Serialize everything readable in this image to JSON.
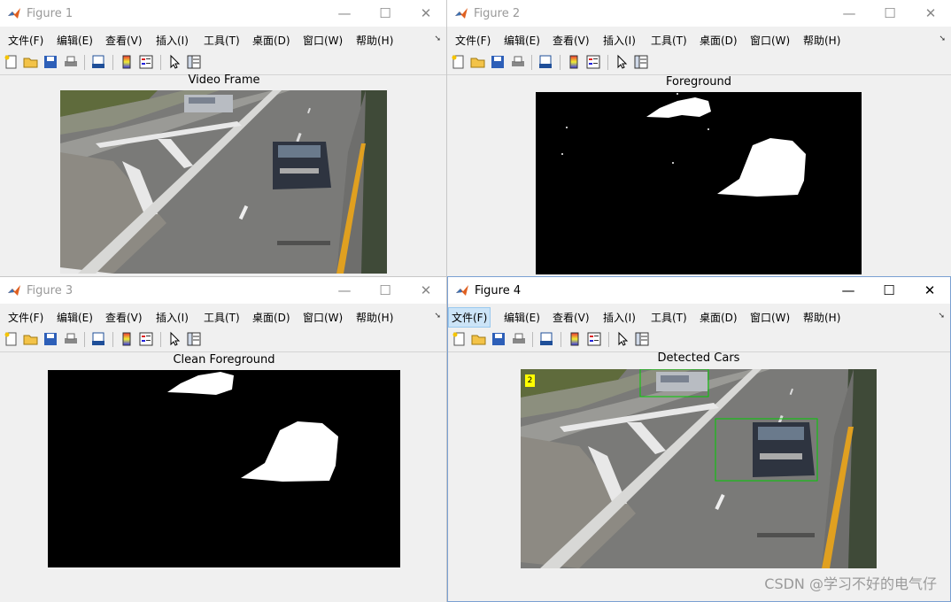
{
  "menu_labels": [
    "文件(F)",
    "编辑(E)",
    "查看(V)",
    "插入(I)",
    "工具(T)",
    "桌面(D)",
    "窗口(W)",
    "帮助(H)"
  ],
  "toolbar_icons": [
    "new-figure-icon",
    "open-file-icon",
    "save-icon",
    "print-icon",
    "print-preview-icon",
    "colorbar-icon",
    "legend-icon",
    "edit-plot-arrow-icon",
    "property-inspector-icon"
  ],
  "figure1": {
    "title": "Figure 1",
    "axes_title": "Video Frame"
  },
  "figure2": {
    "title": "Figure 2",
    "axes_title": "Foreground"
  },
  "figure3": {
    "title": "Figure 3",
    "axes_title": "Clean Foreground"
  },
  "figure4": {
    "title": "Figure 4",
    "axes_title": "Detected Cars",
    "active_menu": "文件(F)",
    "car_count": "2",
    "box_color": "#00cc00",
    "count_badge_color": "#ffff00"
  },
  "window_buttons": {
    "minimize": "—",
    "maximize": "☐",
    "close": "✕"
  },
  "watermark": "CSDN @学习不好的电气仔"
}
